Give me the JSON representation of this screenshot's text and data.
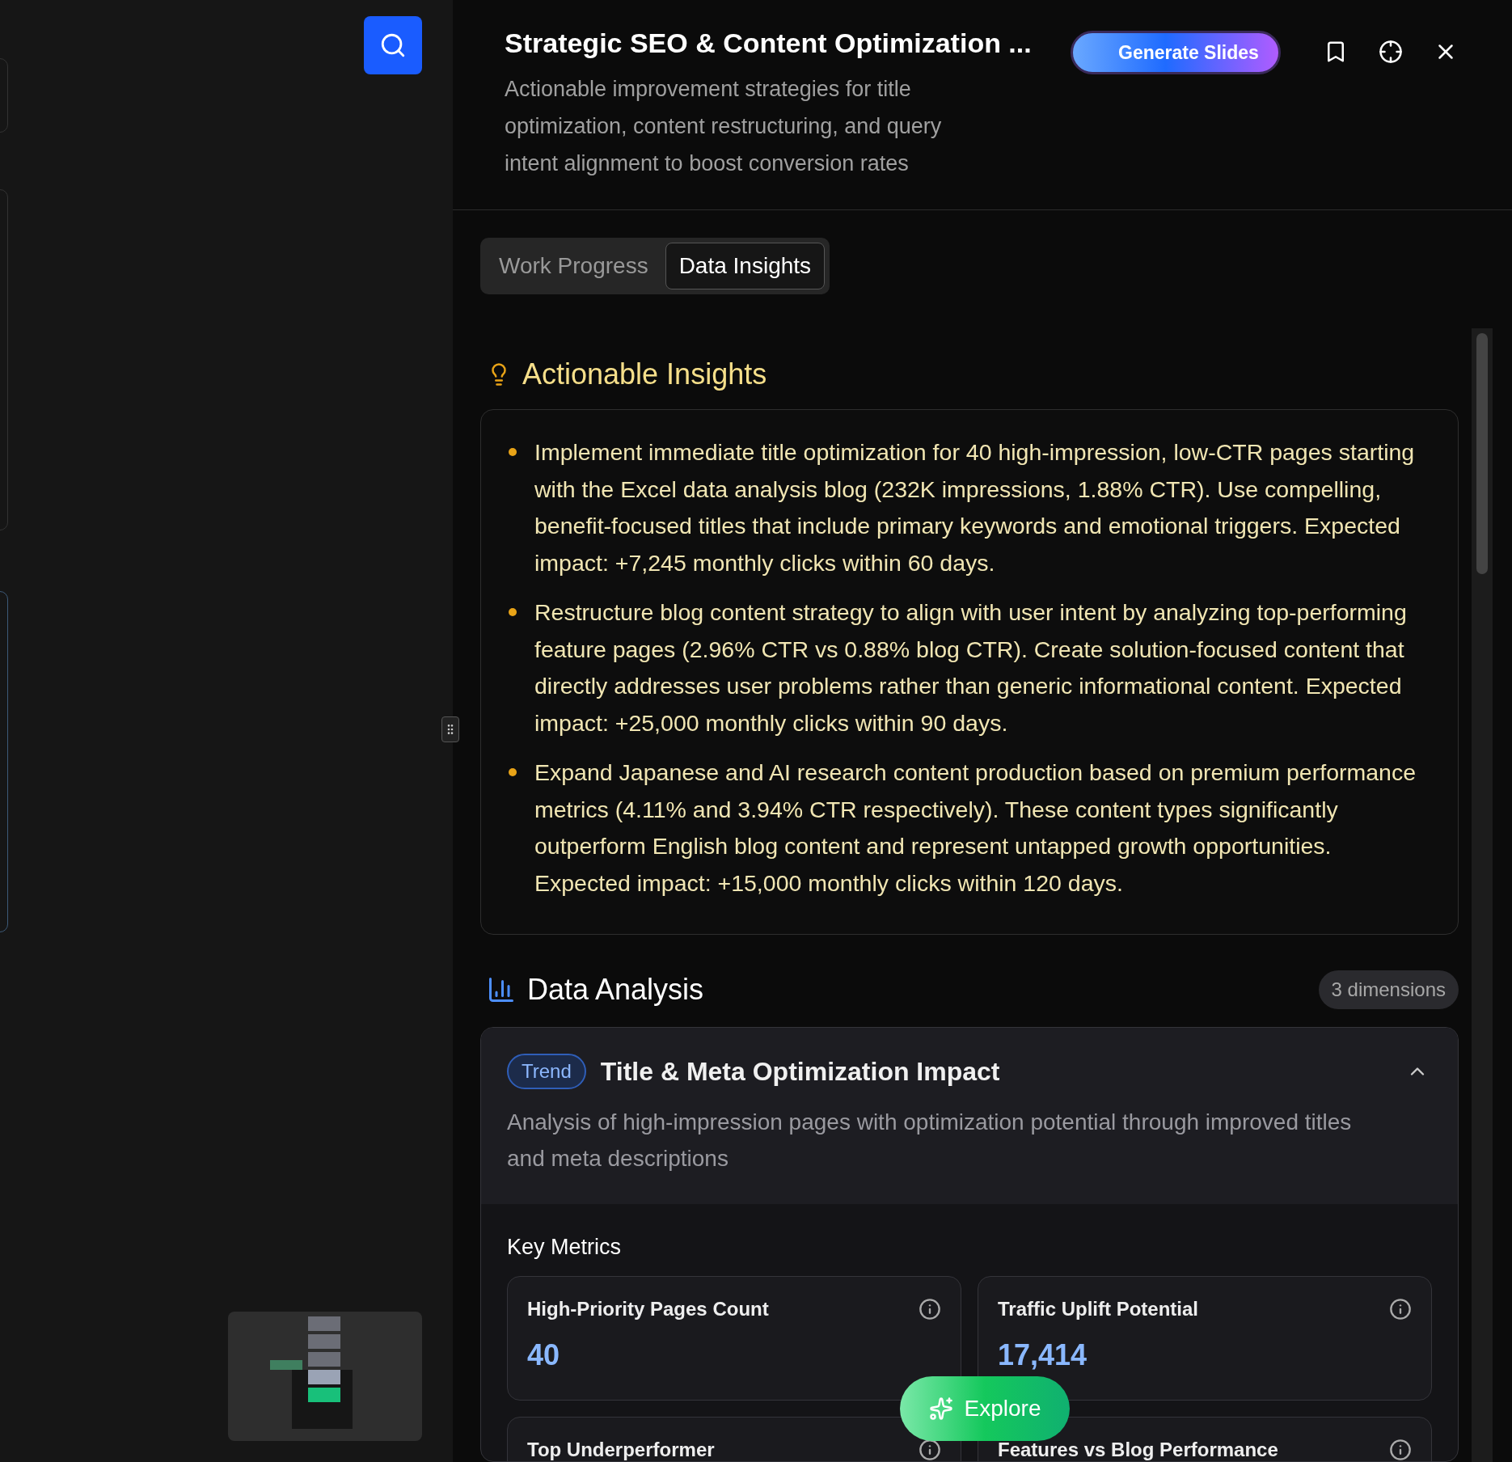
{
  "header": {
    "title": "Strategic SEO & Content Optimization ...",
    "subtitle": "Actionable improvement strategies for title optimization, content restructuring, and query intent alignment to boost conversion rates",
    "generate_button": "Generate Slides"
  },
  "tabs": [
    {
      "label": "Work Progress",
      "selected": false
    },
    {
      "label": "Data Insights",
      "selected": true
    }
  ],
  "insights": {
    "heading": "Actionable Insights",
    "items": [
      "Implement immediate title optimization for 40 high-impression, low-CTR pages starting with the Excel data analysis blog (232K impressions, 1.88% CTR). Use compelling, benefit-focused titles that include primary keywords and emotional triggers. Expected impact: +7,245 monthly clicks within 60 days.",
      "Restructure blog content strategy to align with user intent by analyzing top-performing feature pages (2.96% CTR vs 0.88% blog CTR). Create solution-focused content that directly addresses user problems rather than generic informational content. Expected impact: +25,000 monthly clicks within 90 days.",
      "Expand Japanese and AI research content production based on premium performance metrics (4.11% and 3.94% CTR respectively). These content types significantly outperform English blog content and represent untapped growth opportunities. Expected impact: +15,000 monthly clicks within 120 days."
    ]
  },
  "analysis": {
    "heading": "Data Analysis",
    "count_badge": "3 dimensions",
    "dimension": {
      "tag": "Trend",
      "title": "Title & Meta Optimization Impact",
      "expanded": true,
      "description": "Analysis of high-impression pages with optimization potential through improved titles and meta descriptions",
      "metrics_heading": "Key Metrics",
      "metrics": [
        {
          "label": "High-Priority Pages Count",
          "value": "40"
        },
        {
          "label": "Traffic Uplift Potential",
          "value": "17,414"
        },
        {
          "label": "Top Underperformer"
        },
        {
          "label": "Features vs Blog Performance"
        }
      ]
    }
  },
  "explore_button": "Explore"
}
